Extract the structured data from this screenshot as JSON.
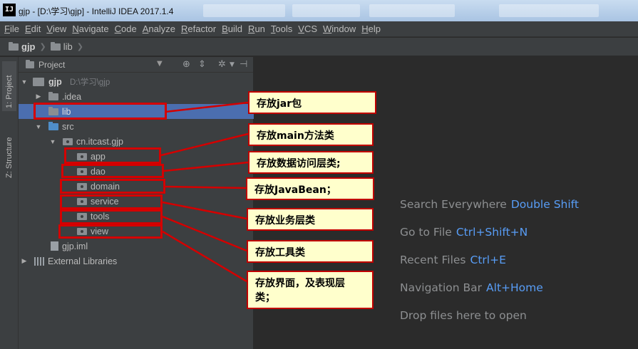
{
  "window": {
    "title": "gjp - [D:\\学习\\gjp] - IntelliJ IDEA 2017.1.4",
    "app_icon": "IJ"
  },
  "menu": [
    "File",
    "Edit",
    "View",
    "Navigate",
    "Code",
    "Analyze",
    "Refactor",
    "Build",
    "Run",
    "Tools",
    "VCS",
    "Window",
    "Help"
  ],
  "breadcrumb": [
    "gjp",
    "lib"
  ],
  "toolwindow_tabs": {
    "project": "1: Project",
    "structure": "Z: Structure"
  },
  "project_panel": {
    "title": "Project",
    "tree": {
      "root": {
        "name": "gjp",
        "path": "D:\\学习\\gjp"
      },
      "idea": ".idea",
      "lib": "lib",
      "src": "src",
      "package": "cn.itcast.gjp",
      "subpackages": [
        "app",
        "dao",
        "domain",
        "service",
        "tools",
        "view"
      ],
      "iml": "gjp.iml",
      "external": "External Libraries"
    }
  },
  "editor_hints": [
    {
      "label": "Search Everywhere",
      "key": "Double Shift"
    },
    {
      "label": "Go to File",
      "key": "Ctrl+Shift+N"
    },
    {
      "label": "Recent Files",
      "key": "Ctrl+E"
    },
    {
      "label": "Navigation Bar",
      "key": "Alt+Home"
    },
    {
      "label": "Drop files here to open",
      "key": ""
    }
  ],
  "callouts": {
    "lib": "存放jar包",
    "app": "存放main方法类",
    "dao": "存放数据访问层类;",
    "domain": "存放JavaBean；",
    "service": "存放业务层类",
    "tools": "存放工具类",
    "view_line1": "存放界面，及表现层",
    "view_line2": "类；"
  },
  "colors": {
    "callout_bg": "#ffffcc",
    "callout_border": "#c00000",
    "selection": "#4b6eaf",
    "shortcut": "#589df6"
  }
}
